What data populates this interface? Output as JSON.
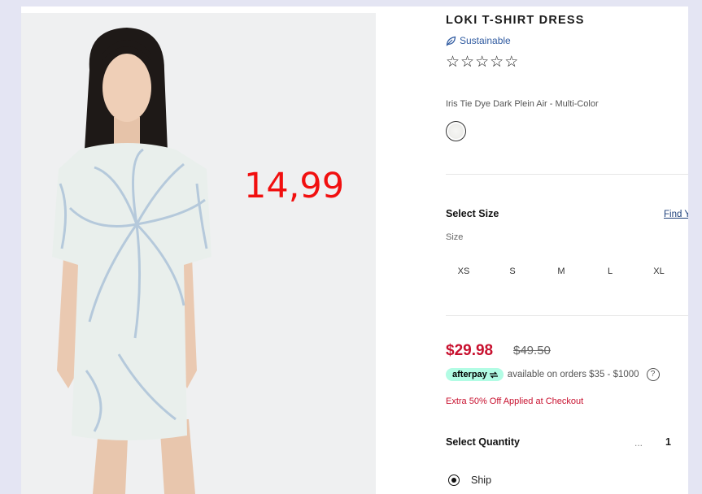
{
  "overlay_price": "14,99",
  "product": {
    "title": "LOKI T-SHIRT DRESS",
    "sustainable_label": "Sustainable",
    "rating_stars": 0,
    "stars": [
      "☆",
      "☆",
      "☆",
      "☆",
      "☆"
    ],
    "color_name": "Iris Tie Dye Dark Plein Air - Multi-Color"
  },
  "size": {
    "heading": "Select Size",
    "find_link": "Find Y",
    "caption": "Size",
    "options": [
      "XS",
      "S",
      "M",
      "L",
      "XL"
    ]
  },
  "pricing": {
    "sale_price": "$29.98",
    "original_price": "$49.50",
    "afterpay_label": "afterpay",
    "afterpay_text": "available on orders $35 - $1000",
    "help_glyph": "?",
    "promo_text": "Extra 50% Off Applied at Checkout"
  },
  "quantity": {
    "heading": "Select Quantity",
    "decrement": "...",
    "value": "1"
  },
  "fulfillment": {
    "ship_label": "Ship",
    "ship_selected": true
  },
  "colors": {
    "sale_red": "#c8102e",
    "overlay_red": "#f10f0f",
    "afterpay_mint": "#b2fce4",
    "sustain_blue": "#2f5aa0"
  }
}
